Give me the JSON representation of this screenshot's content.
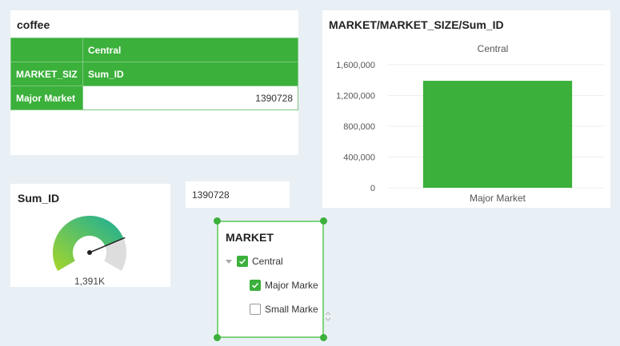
{
  "table_panel": {
    "title": "coffee",
    "header_row1": [
      "",
      "Central"
    ],
    "header_row2": [
      "MARKET_SIZ",
      "Sum_ID"
    ],
    "rows": [
      {
        "label": "Major Market",
        "value": "1390728"
      }
    ]
  },
  "chart_panel": {
    "title": "MARKET/MARKET_SIZE/Sum_ID"
  },
  "gauge_panel": {
    "title": "Sum_ID",
    "value_label": "1,391K",
    "fill_fraction": 0.78,
    "colors": {
      "start": "#a6d62a",
      "end": "#19ad9a",
      "track": "#dddddd"
    }
  },
  "kpi_panel": {
    "value": "1390728"
  },
  "filter_panel": {
    "title": "MARKET",
    "items": [
      {
        "label": "Central",
        "checked": true,
        "level": 0
      },
      {
        "label": "Major Marke",
        "checked": true,
        "level": 1
      },
      {
        "label": "Small Marke",
        "checked": false,
        "level": 1
      }
    ]
  },
  "chart_data": {
    "type": "bar",
    "title": "",
    "facet": "Central",
    "categories": [
      "Major Market"
    ],
    "values": [
      1390728
    ],
    "ylim": [
      0,
      1600000
    ],
    "yticks": [
      0,
      400000,
      800000,
      1200000,
      1600000
    ],
    "ytick_labels": [
      "0",
      "400,000",
      "800,000",
      "1,200,000",
      "1,600,000"
    ],
    "color": "#3bb03b",
    "grid": true
  }
}
